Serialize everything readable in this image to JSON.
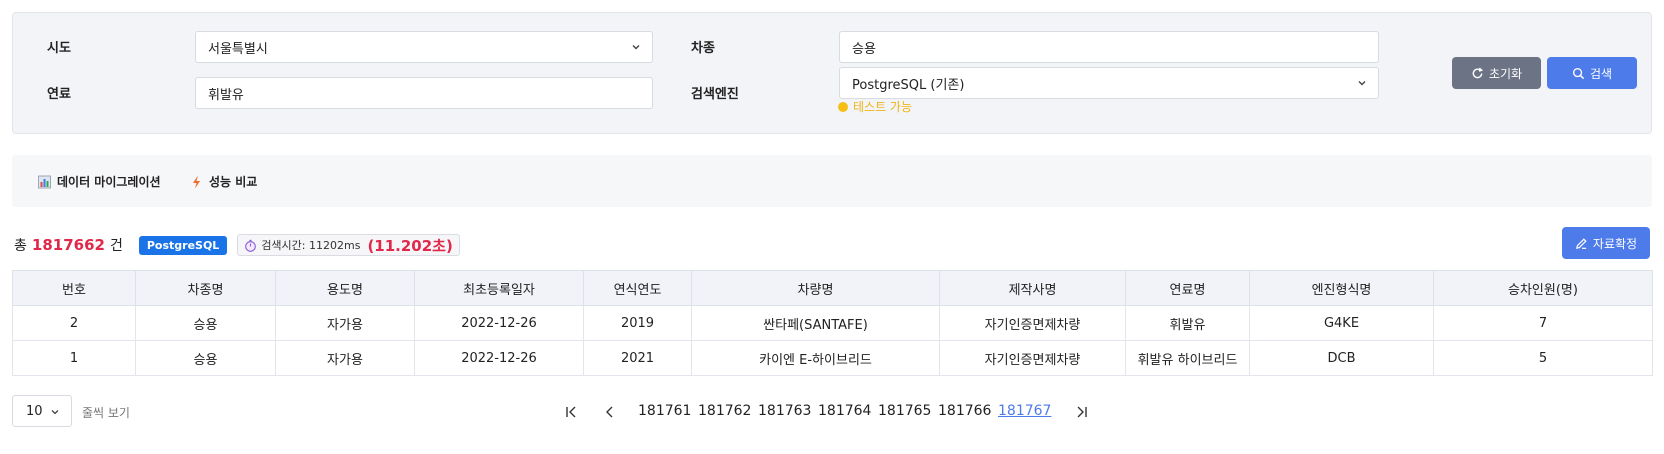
{
  "filters": {
    "sido_label": "시도",
    "sido_value": "서울특별시",
    "car_type_label": "차종",
    "car_type_value": "승용",
    "fuel_label": "연료",
    "fuel_value": "휘발유",
    "engine_label": "검색엔진",
    "engine_value": "PostgreSQL (기존)",
    "engine_status": "테스트 가능",
    "engine_status_color": "#f6be15",
    "reset_label": "초기화",
    "search_label": "검색"
  },
  "tabs": [
    {
      "label": "데이터 마이그레이션",
      "icon": "bar-chart-icon"
    },
    {
      "label": "성능 비교",
      "icon": "lightning-icon"
    }
  ],
  "summary": {
    "prefix": "총",
    "count": "1817662",
    "suffix": "건",
    "engine_badge": "PostgreSQL",
    "time_label": "검색시간: 11202ms",
    "time_seconds": "(11.202초)",
    "confirm_label": "자료확정"
  },
  "table": {
    "headers": [
      "번호",
      "차종명",
      "용도명",
      "최초등록일자",
      "연식연도",
      "차량명",
      "제작사명",
      "연료명",
      "엔진형식명",
      "승차인원(명)"
    ],
    "rows": [
      [
        "2",
        "승용",
        "자가용",
        "2022-12-26",
        "2019",
        "싼타페(SANTAFE)",
        "자기인증면제차량",
        "휘발유",
        "G4KE",
        "7"
      ],
      [
        "1",
        "승용",
        "자가용",
        "2022-12-26",
        "2021",
        "카이엔 E-하이브리드",
        "자기인증면제차량",
        "휘발유 하이브리드",
        "DCB",
        "5"
      ]
    ]
  },
  "pagination": {
    "page_size": "10",
    "page_size_label": "줄씩 보기",
    "pages": [
      "181761",
      "181762",
      "181763",
      "181764",
      "181765",
      "181766",
      "181767"
    ],
    "current": "181767"
  },
  "colors": {
    "accent": "#4e7bea",
    "count_red": "#e0284a",
    "engine_badge": "#1b73e8",
    "reset_button": "#6b7385"
  }
}
